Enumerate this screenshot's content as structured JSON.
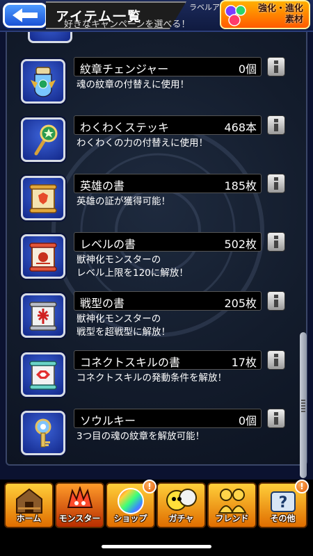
{
  "header": {
    "title": "アイテム一覧",
    "ticker_text": "好きなキャンペーンを選べる！",
    "banner_small": "ラベルアップ",
    "evolve_line1": "強化・進化",
    "evolve_line2": "素材"
  },
  "items": [
    {
      "name": "紋章チェンジャー",
      "count": "0個",
      "desc": "魂の紋章の付替えに使用！",
      "icon": "emblem-changer-icon"
    },
    {
      "name": "わくわくステッキ",
      "count": "468本",
      "desc": "わくわくの力の付替えに使用！",
      "icon": "wakuwaku-stick-icon"
    },
    {
      "name": "英雄の書",
      "count": "185枚",
      "desc": "英雄の証が獲得可能！",
      "icon": "hero-book-icon"
    },
    {
      "name": "レベルの書",
      "count": "502枚",
      "desc": "獣神化モンスターの\nレベル上限を120に解放！",
      "icon": "level-book-icon"
    },
    {
      "name": "戦型の書",
      "count": "205枚",
      "desc": "獣神化モンスターの\n戦型を超戦型に解放！",
      "icon": "battle-type-book-icon"
    },
    {
      "name": "コネクトスキルの書",
      "count": "17枚",
      "desc": "コネクトスキルの発動条件を解放！",
      "icon": "connect-skill-book-icon"
    },
    {
      "name": "ソウルキー",
      "count": "0個",
      "desc": "3つ目の魂の紋章を解放可能！",
      "icon": "soul-key-icon"
    }
  ],
  "nav": [
    {
      "label": "ホーム",
      "icon": "home-icon",
      "badge": ""
    },
    {
      "label": "モンスター",
      "icon": "monster-icon",
      "badge": ""
    },
    {
      "label": "ショップ",
      "icon": "shop-orb-icon",
      "badge": "!"
    },
    {
      "label": "ガチャ",
      "icon": "gacha-icon",
      "badge": ""
    },
    {
      "label": "フレンド",
      "icon": "friend-icon",
      "badge": ""
    },
    {
      "label": "その他",
      "icon": "other-icon",
      "badge": "!"
    }
  ]
}
